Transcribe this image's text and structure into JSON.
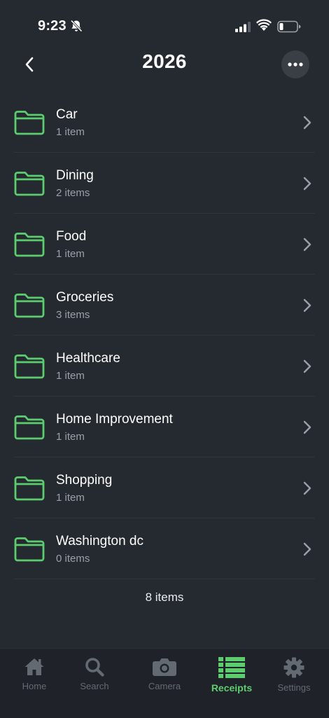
{
  "status_bar": {
    "time": "9:23",
    "icons": [
      "bell-slash-icon",
      "signal-icon",
      "wifi-icon",
      "battery-icon"
    ]
  },
  "header": {
    "title": "2026",
    "back_icon": "chevron-left-icon",
    "more_icon": "ellipsis-icon"
  },
  "folders": [
    {
      "name": "Car",
      "count": "1 item"
    },
    {
      "name": "Dining",
      "count": "2 items"
    },
    {
      "name": "Food",
      "count": "1 item"
    },
    {
      "name": "Groceries",
      "count": "3 items"
    },
    {
      "name": "Healthcare",
      "count": "1 item"
    },
    {
      "name": "Home Improvement",
      "count": "1 item"
    },
    {
      "name": "Shopping",
      "count": "1 item"
    },
    {
      "name": "Washington dc",
      "count": "0 items"
    }
  ],
  "total_count": "8 items",
  "tab_bar": {
    "tabs": [
      {
        "label": "Home",
        "icon": "home-icon",
        "active": false
      },
      {
        "label": "Search",
        "icon": "search-icon",
        "active": false
      },
      {
        "label": "Camera",
        "icon": "camera-icon",
        "active": false
      },
      {
        "label": "Receipts",
        "icon": "list-icon",
        "active": true
      },
      {
        "label": "Settings",
        "icon": "gear-icon",
        "active": false
      }
    ]
  },
  "colors": {
    "background": "#252a31",
    "accent": "#5ccd6e",
    "secondary_text": "#9aa0a8",
    "tab_inactive": "#646a72"
  }
}
